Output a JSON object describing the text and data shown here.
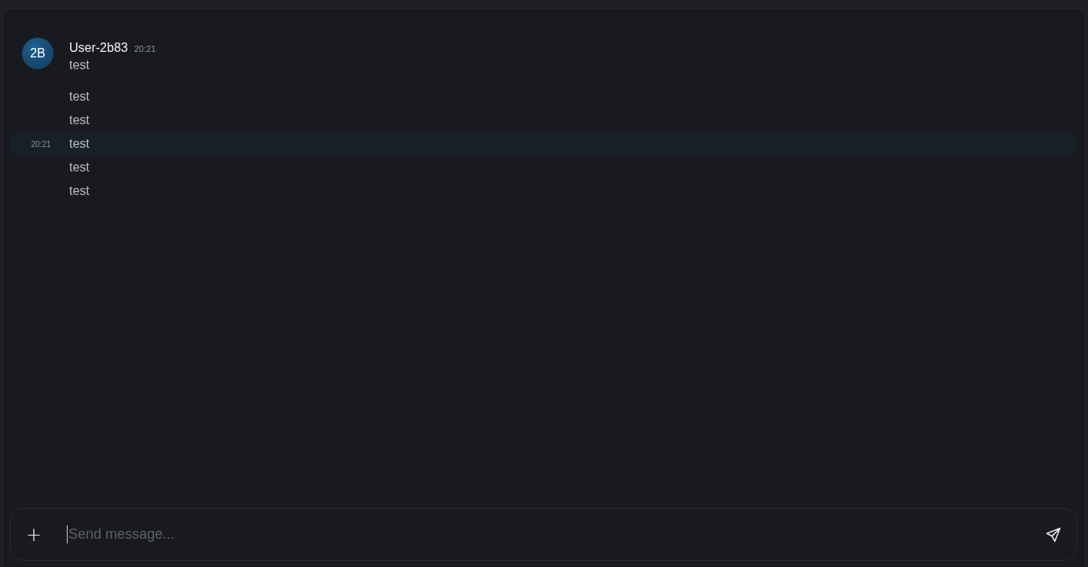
{
  "message_group": {
    "avatar_initials": "2B",
    "author": "User-2b83",
    "time": "20:21",
    "messages": [
      {
        "text": "test",
        "highlighted": false
      },
      {
        "text": "test",
        "highlighted": false
      },
      {
        "text": "test",
        "highlighted": false
      },
      {
        "text": "test",
        "highlighted": true,
        "time": "20:21"
      },
      {
        "text": "test",
        "highlighted": false
      },
      {
        "text": "test",
        "highlighted": false
      }
    ]
  },
  "composer": {
    "add_button": "+",
    "placeholder": "Send message..."
  }
}
